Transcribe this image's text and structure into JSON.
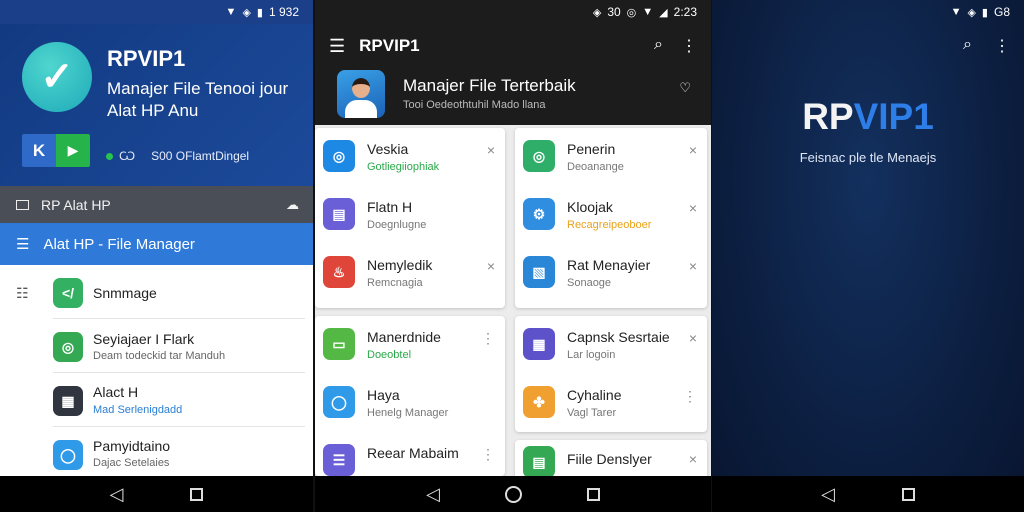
{
  "panel1": {
    "status": {
      "time": "1 932"
    },
    "app_title": "RPVIP1",
    "app_subtitle_line1": "Manajer File Tenooi jour",
    "app_subtitle_line2": "Alat HP Anu",
    "play_k": "K",
    "play_g": "▶",
    "meta_version": "Ѡ",
    "meta_text": "S00 OFlamtDingel",
    "gray_bar_label": "RP Alat HP",
    "toolbar_title": "Alat HP - File Manager",
    "list_header": "Snmmage",
    "items": [
      {
        "title": "Seyiajaer I Flark",
        "subtitle": "Deam todeckid tar Manduh",
        "icon": "chrome-icon",
        "color": "#34a853"
      },
      {
        "title": "Alact H",
        "subtitle": "Mad Serlenigdadd",
        "icon": "tablet-icon",
        "color": "#303540"
      },
      {
        "title": "Pamyidtaino",
        "subtitle": "Dajac Setelaies",
        "icon": "shield-icon",
        "color": "#2f9ae8"
      }
    ]
  },
  "panel2": {
    "status": {
      "time": "2:23",
      "left": "30"
    },
    "title": "RPVIP1",
    "header_title": "Manajer File Terterbaik",
    "header_subtitle": "Tooi Oedeothtuhil Mado llana",
    "cards": [
      {
        "rows": [
          {
            "title": "Veskia",
            "subtitle": "Gotliegiiophiak",
            "subtitle_color": "green",
            "icon": "chrome-icon",
            "color": "#1e88e5",
            "action": "×"
          },
          {
            "title": "Flatn H",
            "subtitle": "Doegnlugne",
            "subtitle_color": "gray",
            "icon": "document-icon",
            "color": "#6a5fd6",
            "action": ""
          },
          {
            "title": "Nemyledik",
            "subtitle": "Remcnagia",
            "subtitle_color": "gray",
            "icon": "flame-icon",
            "color": "#e0453a",
            "action": "×"
          }
        ]
      },
      {
        "rows": [
          {
            "title": "Penerin",
            "subtitle": "Deoanange",
            "subtitle_color": "gray",
            "icon": "chrome-icon",
            "color": "#2fae6a",
            "action": "×"
          },
          {
            "title": "Kloojak",
            "subtitle": "Recagreipeoboer",
            "subtitle_color": "orange",
            "icon": "gear-icon",
            "color": "#2f8ee0",
            "action": "×"
          },
          {
            "title": "Rat Menayier",
            "subtitle": "Sonaoge",
            "subtitle_color": "gray",
            "icon": "folder-icon",
            "color": "#2a86d6",
            "action": "×"
          }
        ]
      },
      {
        "rows": [
          {
            "title": "Manerdnide",
            "subtitle": "Doeobtel",
            "subtitle_color": "green",
            "icon": "file-icon",
            "color": "#53b944",
            "action": "⋮"
          },
          {
            "title": "Haya",
            "subtitle": "Henelg Manager",
            "subtitle_color": "gray",
            "icon": "shield-icon",
            "color": "#2e9ae8",
            "action": ""
          },
          {
            "title": "Reear Mabaim",
            "subtitle": "",
            "subtitle_color": "gray",
            "icon": "list-icon",
            "color": "#6a5fd6",
            "action": "⋮"
          }
        ]
      },
      {
        "rows": [
          {
            "title": "Capnsk Sesrtaie",
            "subtitle": "Lar logoin",
            "subtitle_color": "gray",
            "icon": "calendar-icon",
            "color": "#5d52c9",
            "action": "×"
          },
          {
            "title": "Cyhaline",
            "subtitle": "Vagl Tarer",
            "subtitle_color": "gray",
            "icon": "pinwheel-icon",
            "color": "#f0a030",
            "action": "⋮"
          },
          {
            "title": "Fiile Denslyer",
            "subtitle": "",
            "subtitle_color": "gray",
            "icon": "clipboard-icon",
            "color": "#34a853",
            "action": "×"
          }
        ]
      }
    ]
  },
  "panel3": {
    "status": {
      "time": "G8"
    },
    "title_white": "RP",
    "title_blue": "VIP1",
    "subtitle": "Feisnac ple tle Menaejs"
  }
}
